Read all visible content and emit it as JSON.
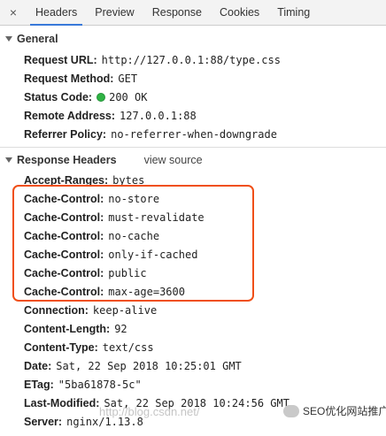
{
  "tabs": {
    "close": "×",
    "items": [
      "Headers",
      "Preview",
      "Response",
      "Cookies",
      "Timing"
    ],
    "active": "Headers"
  },
  "general": {
    "title": "General",
    "rows": [
      {
        "key": "Request URL:",
        "value": "http://127.0.0.1:88/type.css"
      },
      {
        "key": "Request Method:",
        "value": "GET"
      },
      {
        "key": "Status Code:",
        "value": "200 OK",
        "status_color": "#2fb344"
      },
      {
        "key": "Remote Address:",
        "value": "127.0.0.1:88"
      },
      {
        "key": "Referrer Policy:",
        "value": "no-referrer-when-downgrade"
      }
    ]
  },
  "response": {
    "title": "Response Headers",
    "view_source": "view source",
    "rows": [
      {
        "key": "Accept-Ranges:",
        "value": "bytes"
      },
      {
        "key": "Cache-Control:",
        "value": "no-store"
      },
      {
        "key": "Cache-Control:",
        "value": "must-revalidate"
      },
      {
        "key": "Cache-Control:",
        "value": "no-cache"
      },
      {
        "key": "Cache-Control:",
        "value": "only-if-cached"
      },
      {
        "key": "Cache-Control:",
        "value": "public"
      },
      {
        "key": "Cache-Control:",
        "value": "max-age=3600"
      },
      {
        "key": "Connection:",
        "value": "keep-alive"
      },
      {
        "key": "Content-Length:",
        "value": "92"
      },
      {
        "key": "Content-Type:",
        "value": "text/css"
      },
      {
        "key": "Date:",
        "value": "Sat, 22 Sep 2018 10:25:01 GMT"
      },
      {
        "key": "ETag:",
        "value": "\"5ba61878-5c\""
      },
      {
        "key": "Last-Modified:",
        "value": "Sat, 22 Sep 2018 10:24:56 GMT"
      },
      {
        "key": "Server:",
        "value": "nginx/1.13.8"
      }
    ]
  },
  "highlight_color": "#f04f17",
  "watermark": {
    "url": "http://blog.csdn.net/",
    "badge": "SEO优化网站推广"
  }
}
